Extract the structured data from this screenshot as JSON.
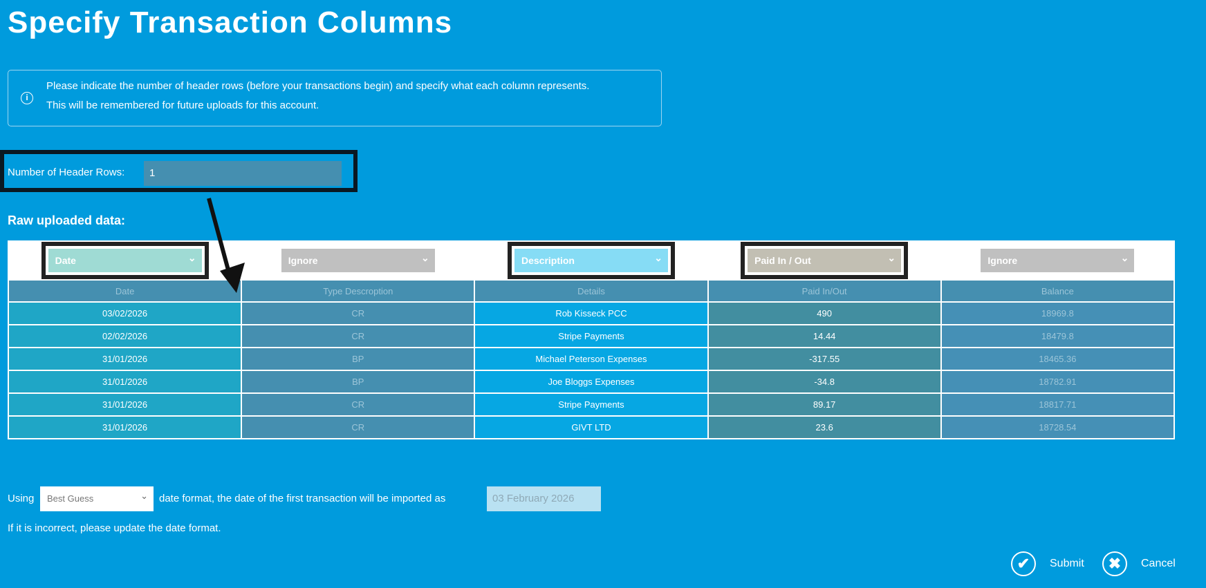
{
  "title": "Specify Transaction Columns",
  "info": {
    "line1": "Please indicate the number of header rows (before your transactions begin) and specify what each column represents.",
    "line2": "This will be remembered for future uploads for this account."
  },
  "header_rows": {
    "label": "Number of Header Rows:",
    "value": "1"
  },
  "raw_label": "Raw uploaded data:",
  "column_selects": [
    {
      "value": "Date",
      "color": "#9fdbd4"
    },
    {
      "value": "Ignore",
      "color": "#c0c0c0"
    },
    {
      "value": "Description",
      "color": "#86dcf5"
    },
    {
      "value": "Paid In / Out",
      "color": "#c2bfb3"
    },
    {
      "value": "Ignore",
      "color": "#c0c0c0"
    }
  ],
  "columns": [
    "Date",
    "Type Descroption",
    "Details",
    "Paid In/Out",
    "Balance"
  ],
  "rows": [
    [
      "03/02/2026",
      "CR",
      "Rob Kisseck PCC",
      "490",
      "18969.8"
    ],
    [
      "02/02/2026",
      "CR",
      "Stripe Payments",
      "14.44",
      "18479.8"
    ],
    [
      "31/01/2026",
      "BP",
      "Michael Peterson Expenses",
      "-317.55",
      "18465.36"
    ],
    [
      "31/01/2026",
      "BP",
      "Joe Bloggs Expenses",
      "-34.8",
      "18782.91"
    ],
    [
      "31/01/2026",
      "CR",
      "Stripe Payments",
      "89.17",
      "18817.71"
    ],
    [
      "31/01/2026",
      "CR",
      "GIVT LTD",
      "23.6",
      "18728.54"
    ]
  ],
  "bottom": {
    "using": "Using",
    "format": "Best Guess",
    "text": "date format, the date of the first transaction will be imported as",
    "date": "03 February 2026",
    "note": "If it is incorrect, please update the date format."
  },
  "buttons": {
    "submit": "Submit",
    "cancel": "Cancel"
  }
}
